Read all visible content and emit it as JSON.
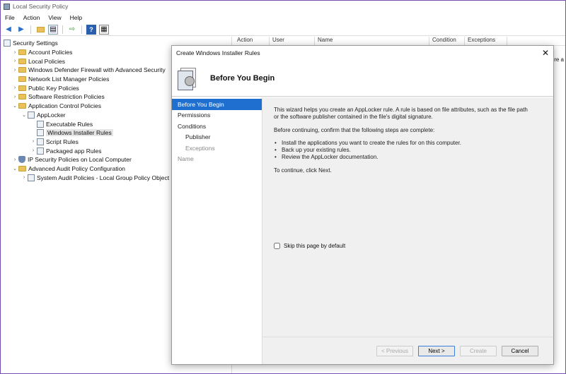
{
  "window": {
    "title": "Local Security Policy"
  },
  "menu": [
    "File",
    "Action",
    "View",
    "Help"
  ],
  "tree": [
    {
      "label": "Security Settings",
      "level": 0,
      "chevron": "",
      "icon": "doc"
    },
    {
      "label": "Account Policies",
      "level": 1,
      "chevron": ">",
      "icon": "folder"
    },
    {
      "label": "Local Policies",
      "level": 1,
      "chevron": ">",
      "icon": "folder"
    },
    {
      "label": "Windows Defender Firewall with Advanced Security",
      "level": 1,
      "chevron": ">",
      "icon": "folder"
    },
    {
      "label": "Network List Manager Policies",
      "level": 1,
      "chevron": "",
      "icon": "folder"
    },
    {
      "label": "Public Key Policies",
      "level": 1,
      "chevron": ">",
      "icon": "folder"
    },
    {
      "label": "Software Restriction Policies",
      "level": 1,
      "chevron": ">",
      "icon": "folder"
    },
    {
      "label": "Application Control Policies",
      "level": 1,
      "chevron": "v",
      "icon": "folder"
    },
    {
      "label": "AppLocker",
      "level": 2,
      "chevron": "v",
      "icon": "doc"
    },
    {
      "label": "Executable Rules",
      "level": 3,
      "chevron": "",
      "icon": "doc"
    },
    {
      "label": "Windows Installer Rules",
      "level": 3,
      "chevron": "",
      "icon": "doc",
      "selected": true
    },
    {
      "label": "Script Rules",
      "level": 3,
      "chevron": ">",
      "icon": "doc"
    },
    {
      "label": "Packaged app Rules",
      "level": 3,
      "chevron": ">",
      "icon": "doc"
    },
    {
      "label": "IP Security Policies on Local Computer",
      "level": 1,
      "chevron": ">",
      "icon": "shield"
    },
    {
      "label": "Advanced Audit Policy Configuration",
      "level": 1,
      "chevron": "v",
      "icon": "folder"
    },
    {
      "label": "System Audit Policies - Local Group Policy Object",
      "level": 2,
      "chevron": ">",
      "icon": "doc"
    }
  ],
  "list_columns": [
    "Action",
    "User",
    "Name",
    "Condition",
    "Exceptions"
  ],
  "right_pane_text": "ere a",
  "dialog": {
    "title": "Create Windows Installer Rules",
    "heading": "Before You Begin",
    "steps": [
      {
        "label": "Before You Begin",
        "state": "active",
        "indent": false
      },
      {
        "label": "Permissions",
        "state": "normal",
        "indent": false
      },
      {
        "label": "Conditions",
        "state": "normal",
        "indent": false
      },
      {
        "label": "Publisher",
        "state": "normal",
        "indent": true
      },
      {
        "label": "Exceptions",
        "state": "disabled",
        "indent": true
      },
      {
        "label": "Name",
        "state": "disabled",
        "indent": false
      }
    ],
    "intro": "This wizard helps you create an AppLocker rule. A rule is based on file attributes, such as the file path or the software publisher contained in the file's digital signature.",
    "before_continuing": "Before continuing, confirm that the following steps are complete:",
    "bullets": [
      "Install the applications you want to create the rules for on this computer.",
      "Back up your existing rules.",
      "Review the AppLocker documentation."
    ],
    "continue_text": "To continue, click Next.",
    "skip_label": "Skip this page by default",
    "buttons": {
      "previous": "< Previous",
      "next": "Next >",
      "create": "Create",
      "cancel": "Cancel"
    }
  },
  "colors": {
    "accent": "#1f6fd0",
    "window_border": "#7a4fb0"
  }
}
